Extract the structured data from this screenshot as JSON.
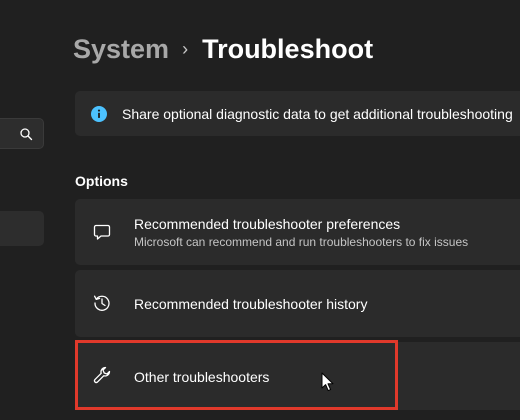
{
  "breadcrumb": {
    "parent": "System",
    "separator": "›",
    "current": "Troubleshoot"
  },
  "sidebar": {
    "search_icon": "search-icon"
  },
  "info_bar": {
    "icon": "info-icon",
    "text": "Share optional diagnostic data to get additional troubleshooting"
  },
  "options": {
    "label": "Options",
    "items": [
      {
        "icon": "chat-bubble-icon",
        "title": "Recommended troubleshooter preferences",
        "subtitle": "Microsoft can recommend and run troubleshooters to fix issues"
      },
      {
        "icon": "history-icon",
        "title": "Recommended troubleshooter history"
      },
      {
        "icon": "wrench-icon",
        "title": "Other troubleshooters"
      }
    ]
  },
  "colors": {
    "background": "#202020",
    "card": "#2b2b2b",
    "accent_info": "#4cc2ff",
    "highlight": "#e0392b"
  }
}
